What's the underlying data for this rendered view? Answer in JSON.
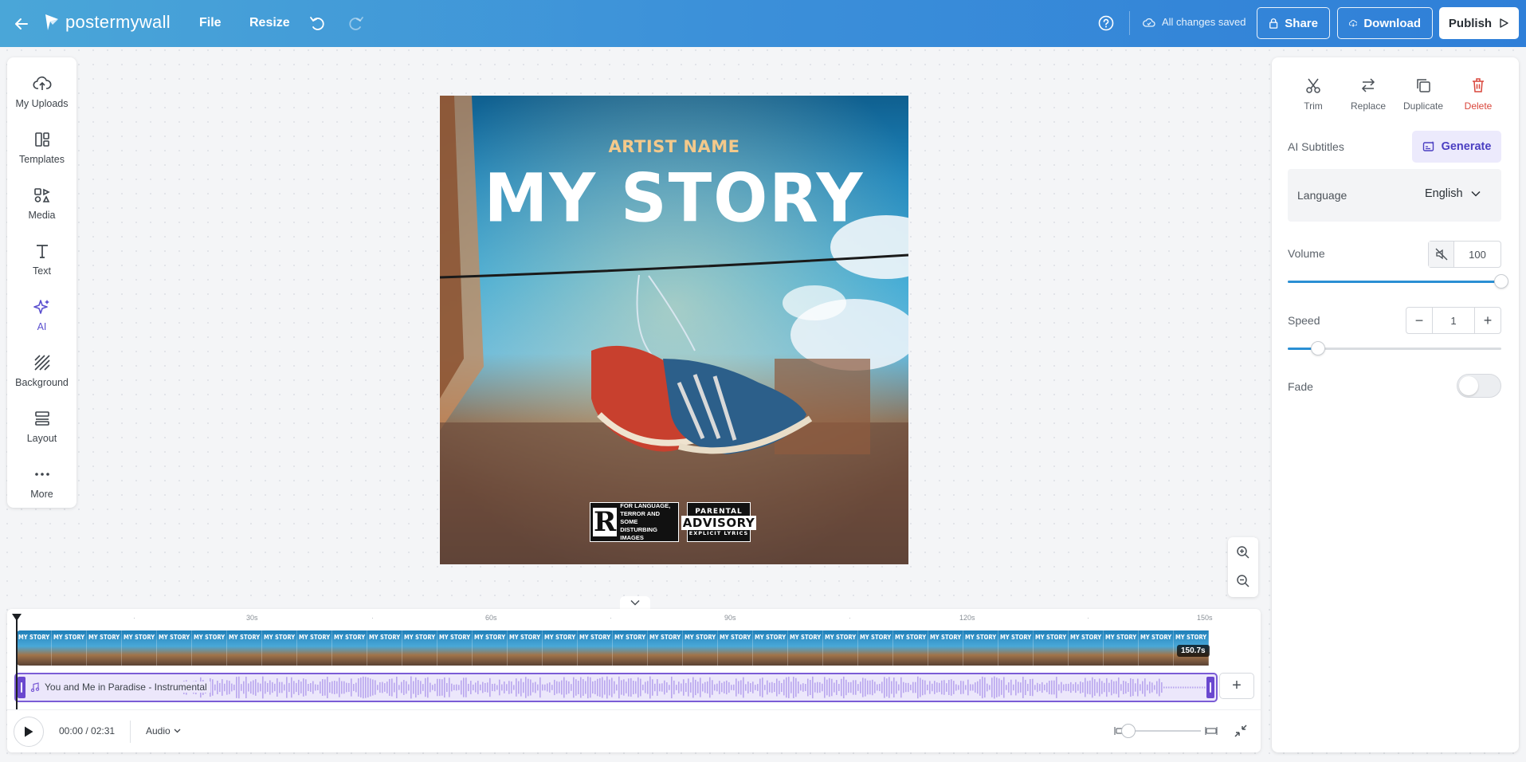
{
  "header": {
    "logo": "postermywall",
    "menu_file": "File",
    "menu_resize": "Resize",
    "status": "All changes saved",
    "share": "Share",
    "download": "Download",
    "publish": "Publish"
  },
  "sidebar": {
    "items": [
      {
        "label": "My Uploads",
        "icon": "upload-cloud-icon"
      },
      {
        "label": "Templates",
        "icon": "templates-icon"
      },
      {
        "label": "Media",
        "icon": "media-icon"
      },
      {
        "label": "Text",
        "icon": "text-icon"
      },
      {
        "label": "AI",
        "icon": "ai-sparkle-icon",
        "active": true
      },
      {
        "label": "Background",
        "icon": "background-hatch-icon"
      },
      {
        "label": "Layout",
        "icon": "layout-icon"
      },
      {
        "label": "More",
        "icon": "more-dots-icon"
      }
    ]
  },
  "poster": {
    "artist": "ARTIST NAME",
    "title": "MY STORY",
    "rating_letter": "R",
    "rating_text_1": "FOR LANGUAGE,",
    "rating_text_2": "TERROR AND SOME",
    "rating_text_3": "DISTURBING IMAGES",
    "advisory_1": "PARENTAL",
    "advisory_2": "ADVISORY",
    "advisory_3": "EXPLICIT LYRICS"
  },
  "panel": {
    "actions": {
      "trim": "Trim",
      "replace": "Replace",
      "duplicate": "Duplicate",
      "delete": "Delete"
    },
    "ai_subtitles_label": "AI Subtitles",
    "generate": "Generate",
    "language_label": "Language",
    "language_value": "English",
    "volume_label": "Volume",
    "volume_value": "100",
    "volume_fraction": 1.0,
    "speed_label": "Speed",
    "speed_value": "1",
    "speed_fraction": 0.14,
    "fade_label": "Fade",
    "fade_on": false
  },
  "timeline": {
    "ruler": [
      "30s",
      "60s",
      "90s",
      "120s",
      "150s"
    ],
    "duration_badge": "150.7s",
    "audio_name": "You and Me in Paradise - Instrumental",
    "time": "00:00 / 02:31",
    "audio_dropdown": "Audio"
  },
  "colors": {
    "accent": "#2f7fd8",
    "ai_purple": "#5a4fcf",
    "audio_track": "#7b5cd6",
    "delete_red": "#d9463b"
  }
}
